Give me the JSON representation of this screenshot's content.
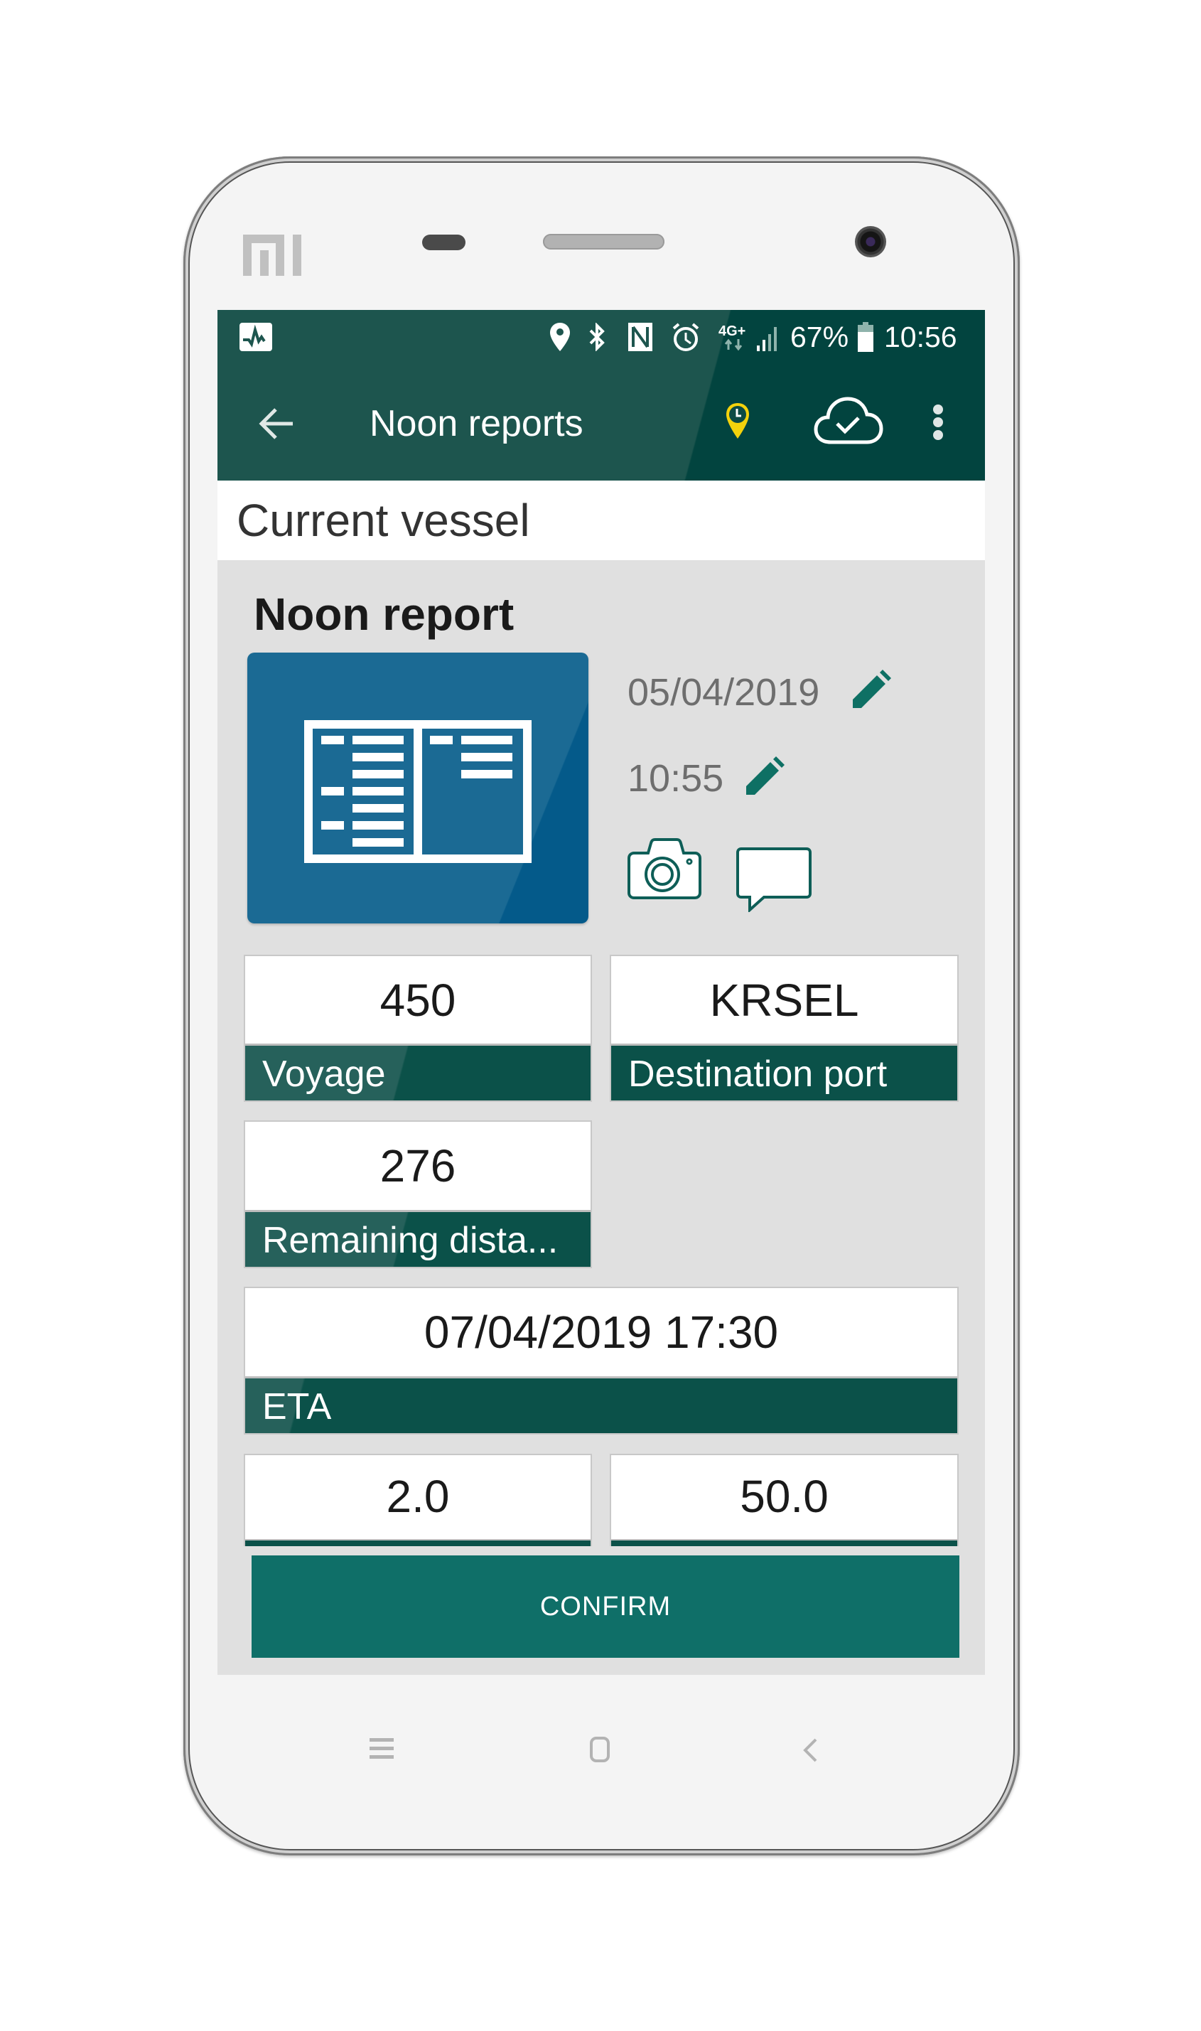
{
  "device": {
    "brand_logo": "MI"
  },
  "status_bar": {
    "left_icon": "activity-monitor-icon",
    "icons": [
      "location-icon",
      "bluetooth-icon",
      "nfc-icon",
      "alarm-icon",
      "network-4g-plus-icon",
      "signal-icon"
    ],
    "network_label": "4G+",
    "battery_percent": "67%",
    "battery_level": 0.67,
    "time": "10:56"
  },
  "app_bar": {
    "title": "Noon reports",
    "back_icon": "back-arrow-icon",
    "actions": [
      "location-clock-icon",
      "cloud-sync-check-icon",
      "more-vert-icon"
    ],
    "accent_color": "#f4d20c",
    "bar_color": "#1d554e"
  },
  "vessel": {
    "label": "Current vessel"
  },
  "report": {
    "title": "Noon report",
    "tile_icon": "report-document-icon",
    "date": "05/04/2019",
    "time": "10:55",
    "photo_icon": "camera-icon",
    "comment_icon": "comment-icon",
    "fields": [
      {
        "value": "450",
        "label": "Voyage"
      },
      {
        "value": "KRSEL",
        "label": "Destination port"
      },
      {
        "value": "276",
        "label": "Remaining dista..."
      },
      {
        "value": "07/04/2019 17:30",
        "label": "ETA"
      },
      {
        "value": "2.0",
        "label": ""
      },
      {
        "value": "50.0",
        "label": ""
      }
    ]
  },
  "actions": {
    "confirm_label": "CONFIRM"
  },
  "nav_bar": {
    "keys": [
      "menu-icon",
      "home-icon",
      "back-icon"
    ]
  }
}
